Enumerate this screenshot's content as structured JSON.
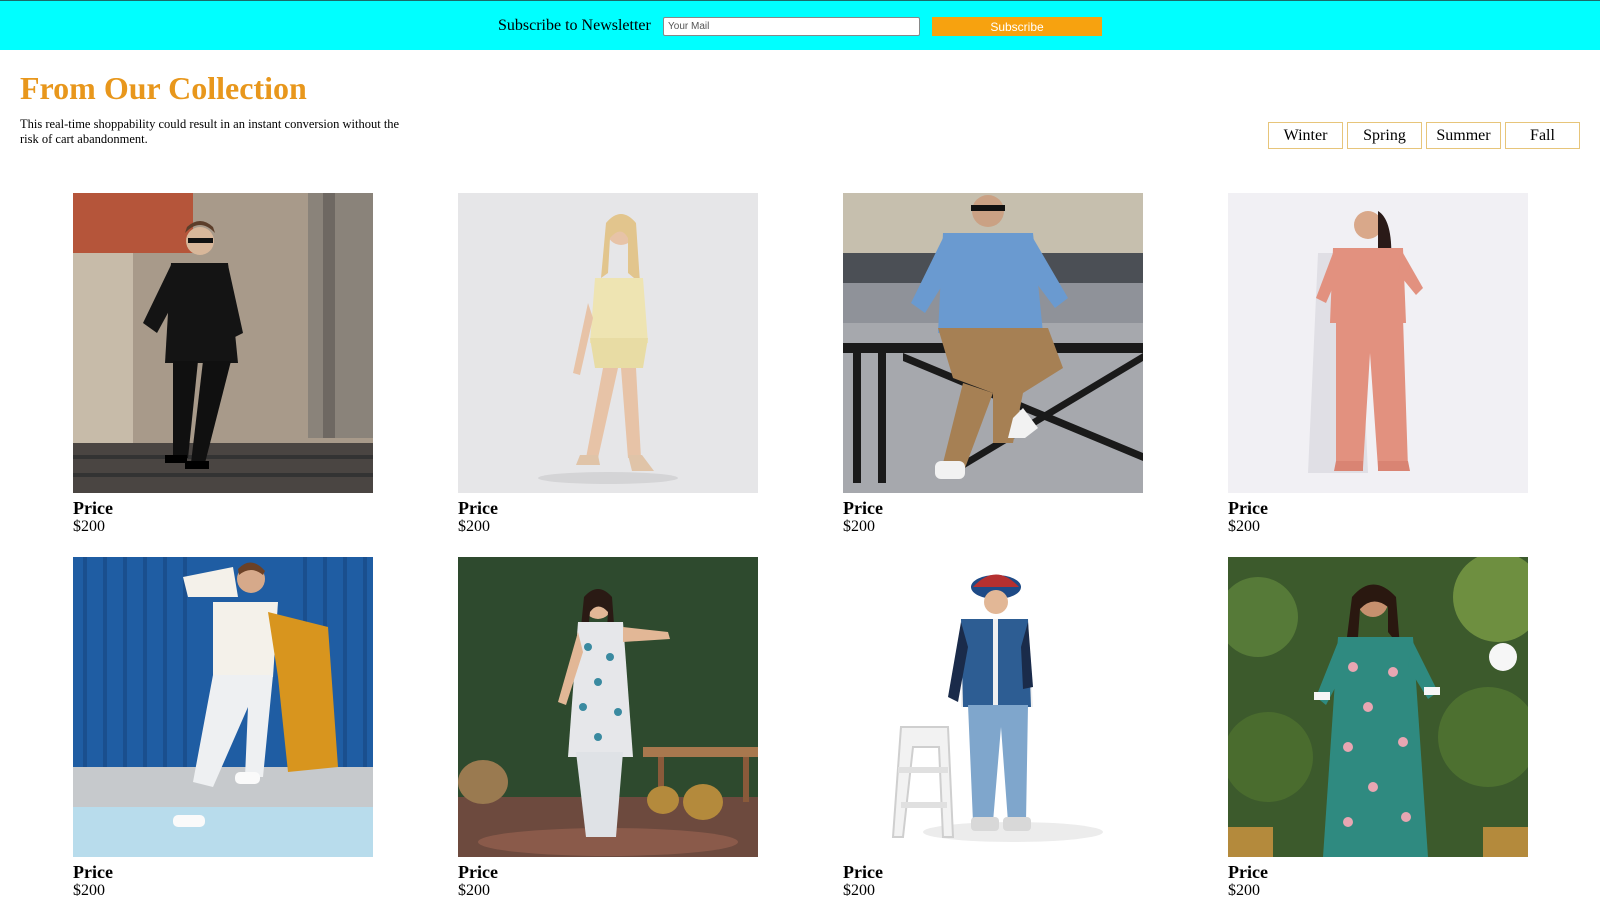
{
  "newsletter": {
    "label": "Subscribe to Newsletter",
    "email_placeholder": "Your Mail",
    "subscribe_label": "Subscribe"
  },
  "collection": {
    "title": "From Our Collection",
    "description": "This real-time shoppability could result in an instant conversion without the risk of cart abandonment."
  },
  "seasons": [
    "Winter",
    "Spring",
    "Summer",
    "Fall"
  ],
  "products": [
    {
      "label": "Price",
      "price": "$200",
      "photo": "man-black-suit-photo"
    },
    {
      "label": "Price",
      "price": "$200",
      "photo": "woman-yellow-dress-photo"
    },
    {
      "label": "Price",
      "price": "$200",
      "photo": "man-denim-shirt-photo"
    },
    {
      "label": "Price",
      "price": "$200",
      "photo": "woman-peach-set-photo"
    },
    {
      "label": "Price",
      "price": "$200",
      "photo": "man-white-outfit-photo"
    },
    {
      "label": "Price",
      "price": "$200",
      "photo": "woman-floral-kurta-photo"
    },
    {
      "label": "Price",
      "price": "$200",
      "photo": "man-denim-vest-photo"
    },
    {
      "label": "Price",
      "price": "$200",
      "photo": "woman-green-kurta-photo"
    }
  ],
  "colors": {
    "banner": "#00ffff",
    "accent": "#e8971c",
    "button": "#f7a20f",
    "tab_border": "#e7c57a"
  }
}
